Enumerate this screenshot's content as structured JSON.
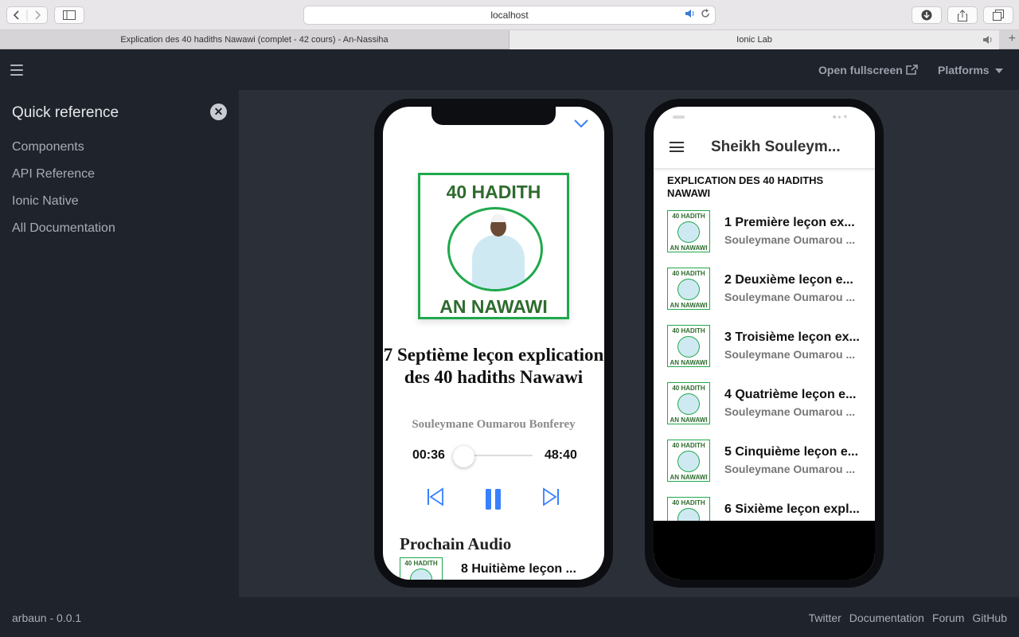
{
  "browser": {
    "address": "localhost",
    "tabs": [
      {
        "label": "Explication des 40 hadiths Nawawi (complet - 42 cours) - An-Nassiha"
      },
      {
        "label": "Ionic Lab"
      }
    ],
    "new_tab_glyph": "+"
  },
  "lab": {
    "open_fullscreen": "Open fullscreen",
    "platforms": "Platforms"
  },
  "sidebar": {
    "title": "Quick reference",
    "items": [
      {
        "label": "Components"
      },
      {
        "label": "API Reference"
      },
      {
        "label": "Ionic Native"
      },
      {
        "label": "All Documentation"
      }
    ]
  },
  "footer": {
    "version": "arbaun - 0.0.1",
    "links": [
      {
        "label": "Twitter"
      },
      {
        "label": "Documentation"
      },
      {
        "label": "Forum"
      },
      {
        "label": "GitHub"
      }
    ]
  },
  "player": {
    "cover_top": "40 HADITH",
    "cover_bottom": "AN NAWAWI",
    "title": "7 Septième leçon explication des 40 hadiths Nawawi",
    "artist": "Souleymane Oumarou Bonferey",
    "current_time": "00:36",
    "duration": "48:40",
    "progress_fraction": 0.012,
    "next_heading": "Prochain Audio",
    "next_title": "8 Huitième leçon ..."
  },
  "list": {
    "header_title": "Sheikh Souleym...",
    "section_title": "EXPLICATION DES 40 HADITHS NAWAWI",
    "thumb_top": "40 HADITH",
    "thumb_bottom": "AN NAWAWI",
    "items": [
      {
        "title": "1 Première leçon ex...",
        "subtitle": "Souleymane Oumarou ..."
      },
      {
        "title": "2 Deuxième leçon e...",
        "subtitle": "Souleymane Oumarou ..."
      },
      {
        "title": "3 Troisième leçon ex...",
        "subtitle": "Souleymane Oumarou ..."
      },
      {
        "title": "4 Quatrième leçon e...",
        "subtitle": "Souleymane Oumarou ..."
      },
      {
        "title": "5 Cinquième leçon e...",
        "subtitle": "Souleymane Oumarou ..."
      },
      {
        "title": "6 Sixième leçon expl..."
      }
    ]
  },
  "colors": {
    "accent": "#3880ff",
    "cover_green": "#1fa84c",
    "cover_text": "#2f6b2f"
  }
}
